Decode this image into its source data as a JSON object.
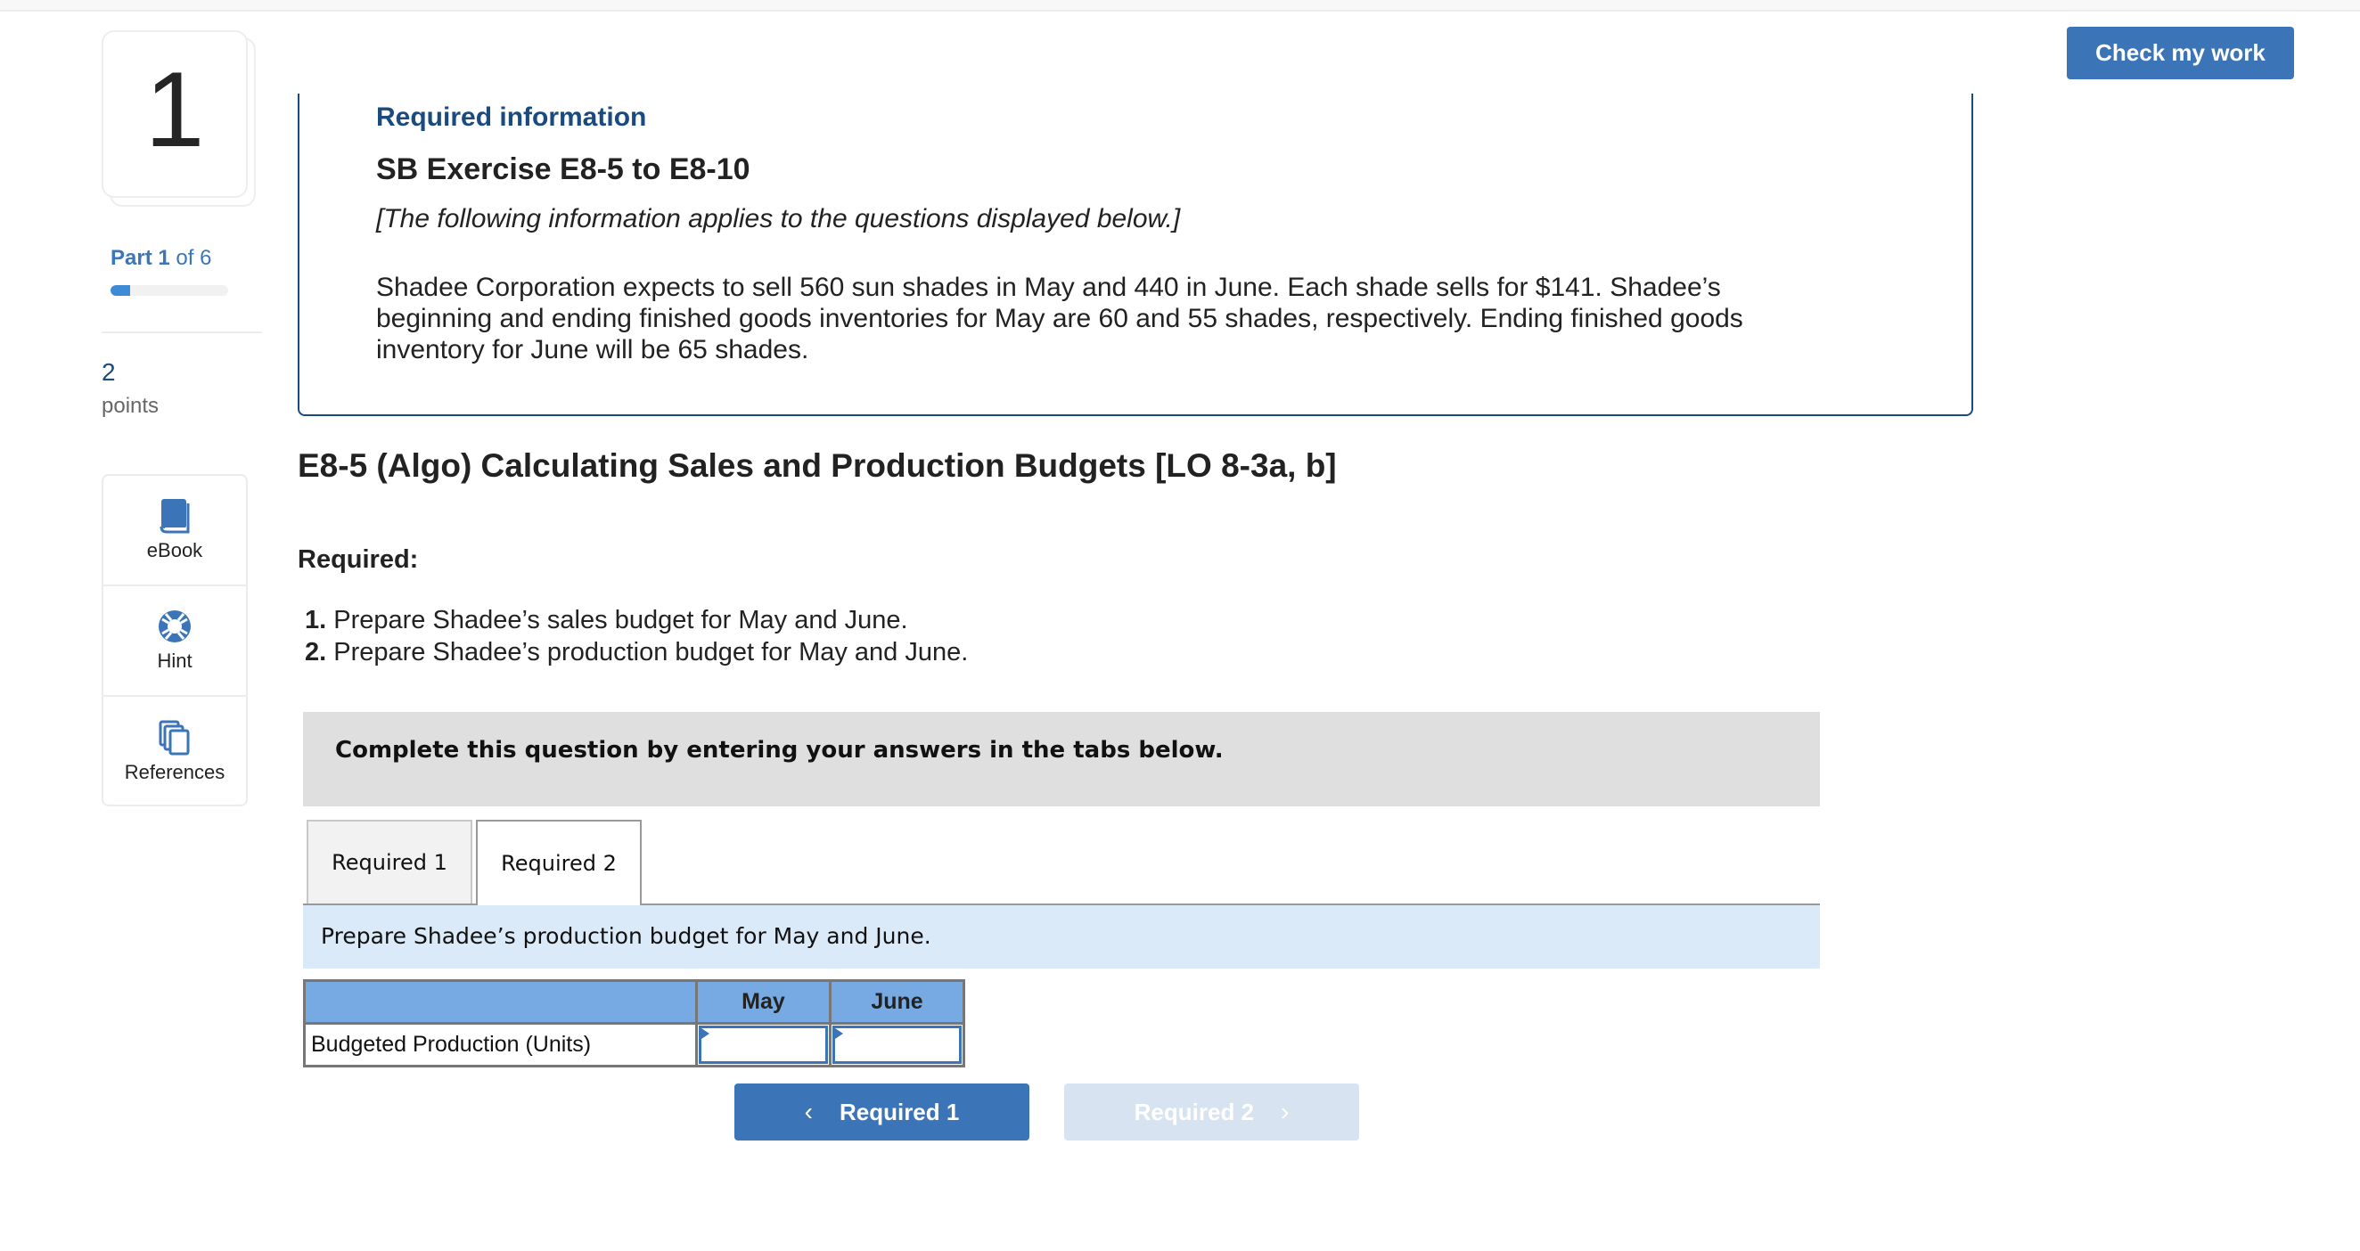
{
  "header": {
    "check_button_label": "Check my work"
  },
  "sidebar": {
    "question_number": "1",
    "part_label": "Part",
    "part_current": "1",
    "part_of_label": "of 6",
    "progress_fraction": 0.1667,
    "points_value": "2",
    "points_label": "points",
    "tools": [
      {
        "label": "eBook",
        "icon": "book-icon"
      },
      {
        "label": "Hint",
        "icon": "lifebuoy-icon"
      },
      {
        "label": "References",
        "icon": "documents-icon"
      }
    ]
  },
  "info_box": {
    "heading": "Required information",
    "set_title": "SB Exercise E8-5 to E8-10",
    "note": "[The following information applies to the questions displayed below.]",
    "scenario": "Shadee Corporation expects to sell 560 sun shades in May and 440 in June. Each shade sells for $141. Shadee’s beginning and ending finished goods inventories for May are 60 and 55 shades, respectively. Ending finished goods inventory for June will be 65 shades."
  },
  "exercise": {
    "title": "E8-5 (Algo) Calculating Sales and Production Budgets [LO 8-3a, b]",
    "required_heading": "Required:",
    "requirements": [
      {
        "num": "1.",
        "text": " Prepare Shadee’s sales budget for May and June."
      },
      {
        "num": "2.",
        "text": " Prepare Shadee’s production budget for May and June."
      }
    ],
    "instruction": "Complete this question by entering your answers in the tabs below."
  },
  "tabs": [
    {
      "label": "Required 1",
      "active": false
    },
    {
      "label": "Required 2",
      "active": true
    }
  ],
  "tab_content": {
    "prompt": "Prepare Shadee’s production budget for May and June.",
    "table": {
      "columns": [
        "",
        "May",
        "June"
      ],
      "rows": [
        {
          "label": "Budgeted Production (Units)",
          "may": "",
          "june": ""
        }
      ]
    }
  },
  "navigation": {
    "prev_label": "Required 1",
    "next_label": "Required 2",
    "next_disabled": true
  },
  "colors": {
    "accent": "#3b75b8",
    "info_border": "#1a4a80",
    "table_header": "#77aae2",
    "prompt_bg": "#daeaf8"
  }
}
